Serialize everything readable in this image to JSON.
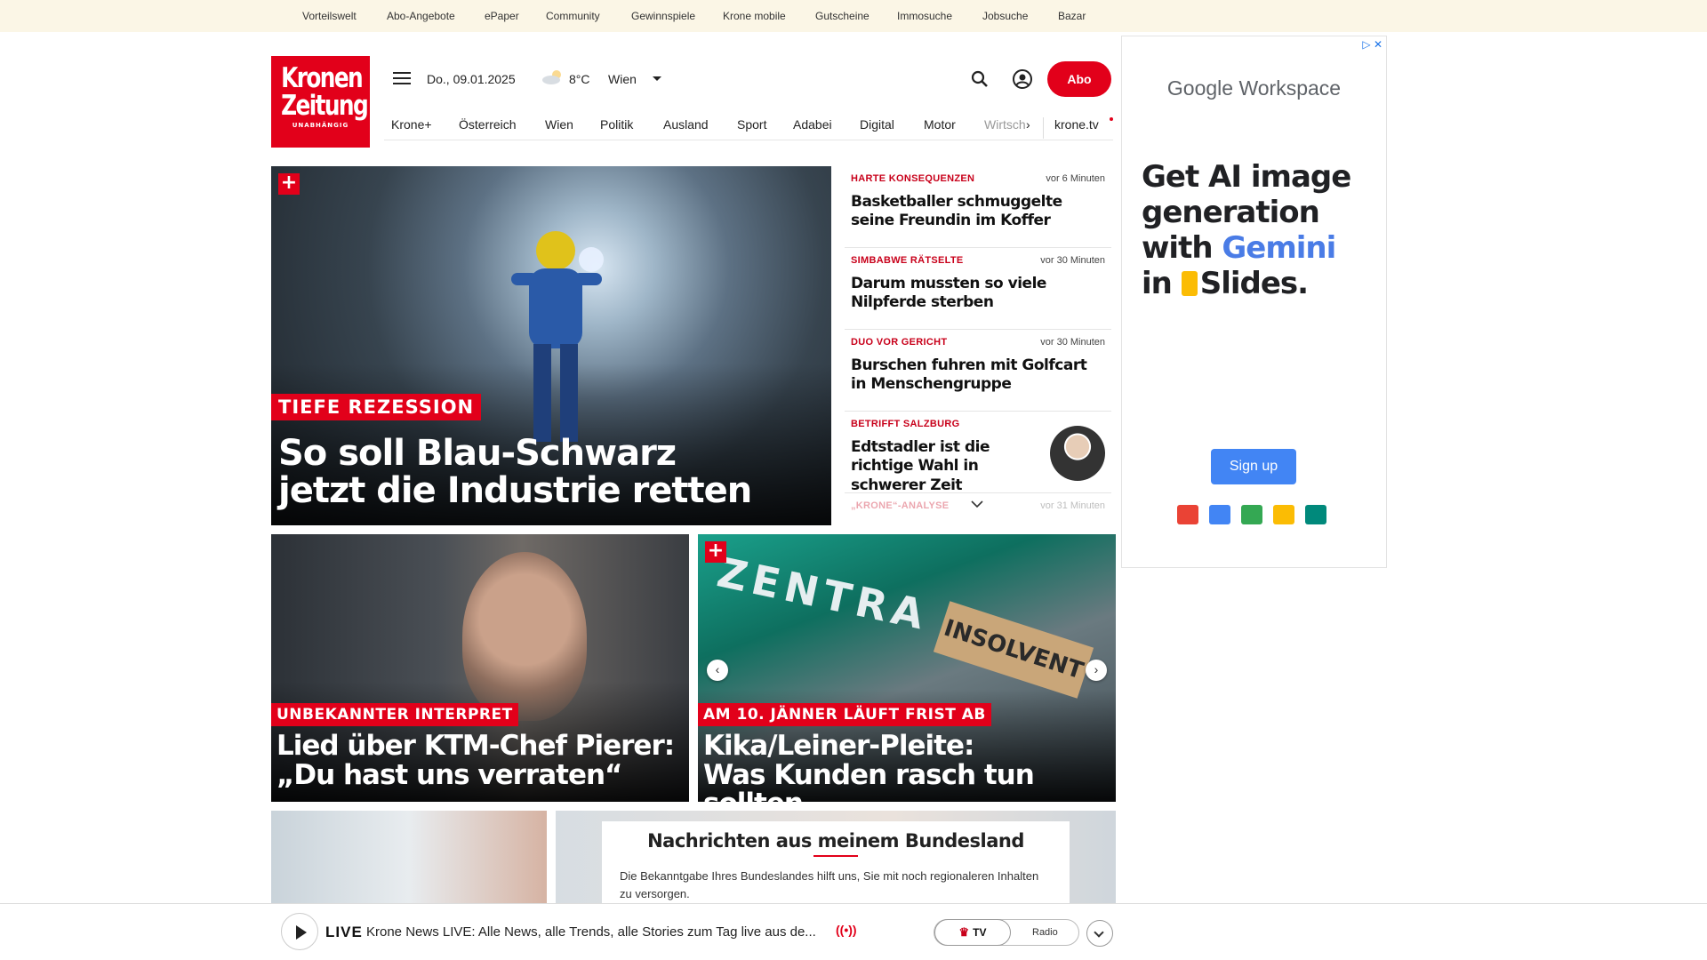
{
  "topbar": {
    "links": [
      "Vorteilswelt",
      "Abo-Angebote",
      "ePaper",
      "Community",
      "Gewinnspiele",
      "Krone mobile",
      "Gutscheine",
      "Immosuche",
      "Jobsuche",
      "Bazar"
    ]
  },
  "logo": {
    "line1": "Kronen",
    "line2": "Zeitung",
    "tagline": "UNABHÄNGIG"
  },
  "header": {
    "date": "Do., 09.01.2025",
    "temperature": "8°C",
    "city": "Wien",
    "abo_label": "Abo",
    "icons": {
      "menu": "hamburger-icon",
      "weather": "cloud-sun-icon",
      "search": "search-icon",
      "account": "user-icon"
    }
  },
  "nav": {
    "items": [
      "Krone+",
      "Österreich",
      "Wien",
      "Politik",
      "Ausland",
      "Sport",
      "Adabei",
      "Digital",
      "Motor",
      "Wirtsch"
    ],
    "tv_label": "krone.tv"
  },
  "hero": {
    "plus": "+",
    "kicker": "TIEFE REZESSION",
    "headline_line1": "So soll Blau-Schwarz",
    "headline_line2": "jetzt die Industrie retten"
  },
  "newslist": [
    {
      "category": "HARTE KONSEQUENZEN",
      "time": "vor 6 Minuten",
      "title": "Basketballer schmuggelte seine Freundin im Koffer"
    },
    {
      "category": "SIMBABWE RÄTSELTE",
      "time": "vor 30 Minuten",
      "title": "Darum mussten so viele Nilpferde sterben"
    },
    {
      "category": "DUO VOR GERICHT",
      "time": "vor 30 Minuten",
      "title": "Burschen fuhren mit Golfcart in Menschengruppe"
    },
    {
      "category": "BETRIFFT SALZBURG",
      "time": "",
      "title": "Edtstadler ist die richtige Wahl in schwerer Zeit"
    },
    {
      "category": "„KRONE“-ANALYSE",
      "time": "vor 31 Minuten",
      "title": ""
    }
  ],
  "cards": {
    "card1": {
      "kicker": "UNBEKANNTER INTERPRET",
      "line1": "Lied über KTM-Chef Pierer:",
      "line2": "„Du hast uns verraten“"
    },
    "card2": {
      "plus": "+",
      "kicker": "AM 10. JÄNNER LÄUFT FRIST AB",
      "line1": "Kika/Leiner-Pleite:",
      "line2": "Was Kunden rasch tun sollten",
      "stamp": "INSOLVENT",
      "sign": "ZENTRA"
    }
  },
  "bundesland": {
    "title": "Nachrichten aus meinem Bundesland",
    "text": "Die Bekanntgabe Ihres Bundeslandes hilft uns, Sie mit noch regionaleren Inhalten zu versorgen."
  },
  "live": {
    "label": "LIVE",
    "text": "Krone News LIVE: Alle News, alle Trends, alle Stories zum Tag live aus de...",
    "tv_label": "TV",
    "radio_label": "Radio"
  },
  "ad": {
    "brand_google": "Google",
    "brand_workspace": "Workspace",
    "line1": "Get AI image",
    "line2": "generation",
    "line3_a": "with ",
    "line3_b": "Gemini",
    "line4_a": "in ",
    "line4_b": "Slides.",
    "cta": "Sign up",
    "colors": {
      "blue": "#4285f4",
      "red": "#ea4335",
      "yellow": "#fbbc04",
      "green": "#34a853"
    }
  },
  "colors": {
    "brand_red": "#e2001a",
    "topbar_bg": "#fbf6e6"
  }
}
